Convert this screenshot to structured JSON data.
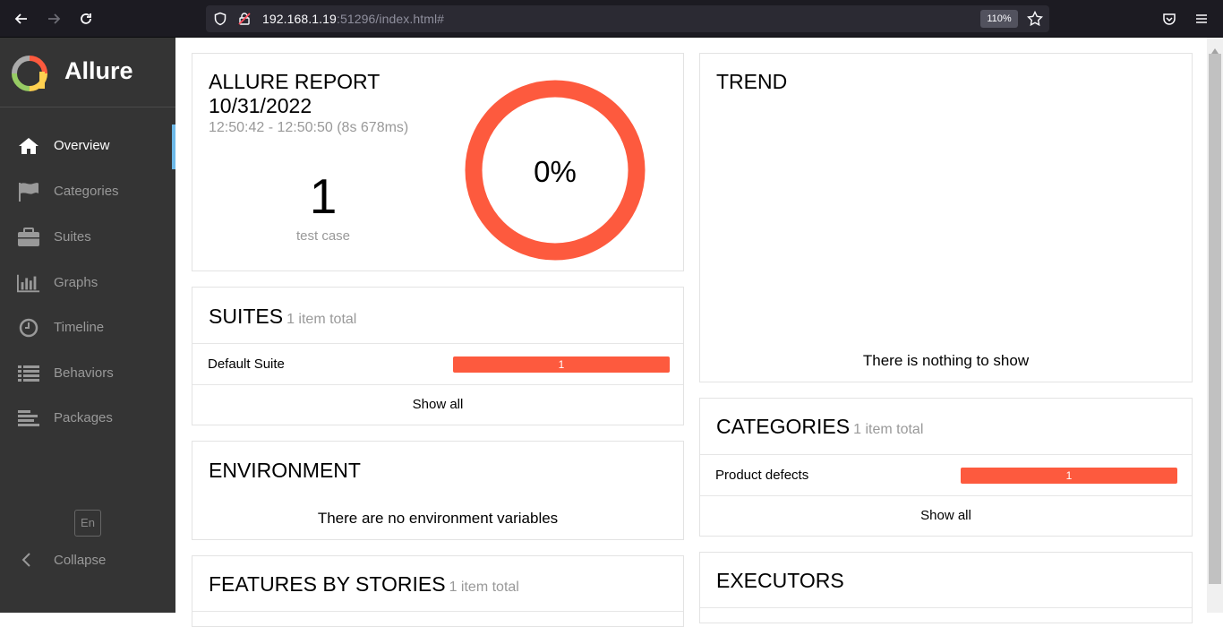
{
  "browser": {
    "url_host": "192.168.1.19",
    "url_rest": ":51296/index.html#",
    "zoom": "110%"
  },
  "sidebar": {
    "brand": "Allure",
    "items": [
      {
        "label": "Overview",
        "icon": "home-icon",
        "active": true
      },
      {
        "label": "Categories",
        "icon": "flag-icon",
        "active": false
      },
      {
        "label": "Suites",
        "icon": "briefcase-icon",
        "active": false
      },
      {
        "label": "Graphs",
        "icon": "bar-chart-icon",
        "active": false
      },
      {
        "label": "Timeline",
        "icon": "clock-icon",
        "active": false
      },
      {
        "label": "Behaviors",
        "icon": "list-icon",
        "active": false
      },
      {
        "label": "Packages",
        "icon": "align-left-icon",
        "active": false
      }
    ],
    "lang": "En",
    "collapse": "Collapse"
  },
  "summary": {
    "title": "ALLURE REPORT",
    "date": "10/31/2022",
    "time_range": "12:50:42 - 12:50:50 (8s 678ms)",
    "test_count": "1",
    "test_count_label": "test case",
    "success_rate": "0%",
    "failed_color": "#fd5a3e"
  },
  "trend": {
    "title": "TREND",
    "empty": "There is nothing to show"
  },
  "suites": {
    "title": "SUITES",
    "count": "1 item total",
    "rows": [
      {
        "name": "Default Suite",
        "value": "1"
      }
    ],
    "show_all": "Show all"
  },
  "categories": {
    "title": "CATEGORIES",
    "count": "1 item total",
    "rows": [
      {
        "name": "Product defects",
        "value": "1"
      }
    ],
    "show_all": "Show all"
  },
  "environment": {
    "title": "ENVIRONMENT",
    "empty": "There are no environment variables"
  },
  "features": {
    "title": "FEATURES BY STORIES",
    "count": "1 item total"
  },
  "executors": {
    "title": "EXECUTORS"
  }
}
